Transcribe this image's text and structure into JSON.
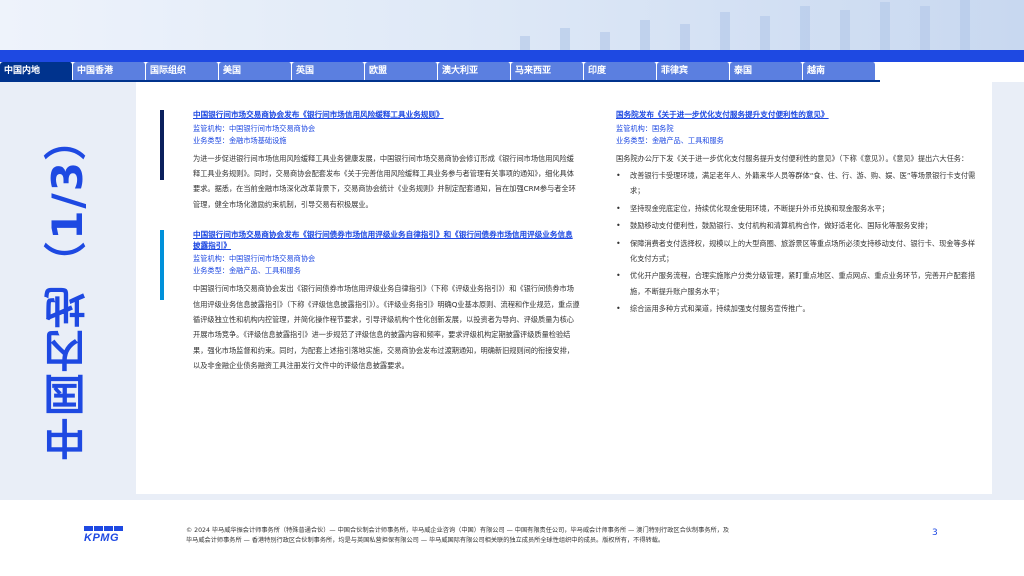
{
  "tabs": [
    {
      "label": "中国内地",
      "active": true
    },
    {
      "label": "中国香港",
      "active": false
    },
    {
      "label": "国际组织",
      "active": false
    },
    {
      "label": "美国",
      "active": false
    },
    {
      "label": "英国",
      "active": false
    },
    {
      "label": "欧盟",
      "active": false
    },
    {
      "label": "澳大利亚",
      "active": false
    },
    {
      "label": "马来西亚",
      "active": false
    },
    {
      "label": "印度",
      "active": false
    },
    {
      "label": "菲律宾",
      "active": false
    },
    {
      "label": "泰国",
      "active": false
    },
    {
      "label": "越南",
      "active": false
    }
  ],
  "side_title": "中国内地（1/3）",
  "left_articles": [
    {
      "title": "中国银行间市场交易商协会发布《银行间市场信用风险缓释工具业务规则》",
      "regulator": "监管机构：中国银行间市场交易商协会",
      "type": "业务类型：金融市场基础设施",
      "body": "为进一步促进银行间市场信用风险缓释工具业务健康发展，中国银行间市场交易商协会修订形成《银行间市场信用风险缓释工具业务规则》。同时，交易商协会配套发布《关于完善信用风险缓释工具业务参与者管理有关事项的通知》，细化具体要求。据悉，在当前金融市场深化改革背景下，交易商协会统计《业务规则》并制定配套通知，旨在加强CRM参与者全环管理，健全市场化激励约束机制，引导交易有积极展业。"
    },
    {
      "title": "中国银行间市场交易商协会发布《银行间债券市场信用评级业务自律指引》和《银行间债券市场信用评级业务信息披露指引》",
      "regulator": "监管机构：中国银行间市场交易商协会",
      "type": "业务类型：金融产品、工具和服务",
      "body": "中国银行间市场交易商协会发出《银行间债券市场信用评级业务自律指引》（下称《评级业务指引》）和《银行间债券市场信用评级业务信息披露指引》（下称《评级信息披露指引》）。《评级业务指引》明确Q业基本原则、流程和作业规范，重点遵循评级独立性和机构内控管理，并简化操作程节要求，引导评级机构个性化创新发展，以投资者为导向、评级质量为核心开展市场竞争。《评级信息披露指引》进一步规范了评级信息的披露内容和频率，要求评级机构定期披露评级质量检验结果，强化市场监督和约束。同时，为配套上述指引落地实施，交易商协会发布过渡期通知，明确新旧规则间的衔接安排，以及非金融企业债务融资工具注册发行文件中的评级信息披露要求。"
    }
  ],
  "right_article": {
    "title": "国务院发布《关于进一步优化支付服务提升支付便利性的意见》",
    "regulator": "监管机构：国务院",
    "type": "业务类型：金融产品、工具和服务",
    "intro": "国务院办公厅下发《关于进一步优化支付服务提升支付便利性的意见》（下称《意见》）。《意见》提出六大任务：",
    "tasks": [
      "改善银行卡受理环境，满足老年人、外籍来华人员等群体“食、住、行、游、购、娱、医”等场景银行卡支付需求；",
      "坚持现金兜底定位，持续优化现金使用环境，不断提升外币兑换和现金服务水平；",
      "鼓励移动支付便利性，鼓励银行、支付机构和清算机构合作，做好适老化、国际化等服务安排；",
      "保障消费者支付选择权，规模以上的大型商圈、旅游景区等重点场所必须支持移动支付、银行卡、现金等多样化支付方式；",
      "优化开户服务流程，合理实施账户分类分级管理，紧盯重点地区、重点网点、重点业务环节，完善开户配套措施，不断提升账户服务水平；",
      "综合运用多种方式和渠道，持续加强支付服务宣传推广。"
    ]
  },
  "footer": {
    "logo": "KPMG",
    "line1": "© 2024 毕马威华振会计师事务所（特殊普通合伙）— 中国合伙制会计师事务所，毕马威企业咨询（中国）有限公司 — 中国有限责任公司，毕马威会计师事务所 — 澳门特别行政区合伙制事务所，及",
    "line2": "毕马威会计师事务所 — 香港特别行政区合伙制事务所，均是与英国私营担保有限公司 — 毕马威国际有限公司相关联的独立成员所全球性组织中的成员。版权所有，不得转载。",
    "page": "3"
  },
  "colors": {
    "kpmg_blue": "#00338d",
    "accent_blue": "#1e49e2",
    "tab_blue": "#5b7fe0",
    "teal": "#0091da",
    "panel_bg": "#e9eef7"
  }
}
